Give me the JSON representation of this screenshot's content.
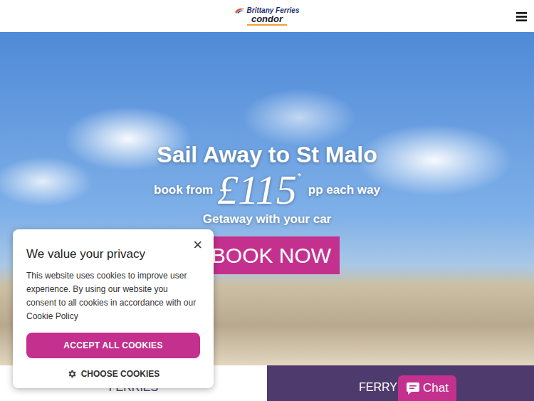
{
  "header": {
    "logo": {
      "brand": "Brittany Ferries",
      "sub": "condor"
    }
  },
  "hero": {
    "title": "Sail Away to St Malo",
    "book_from": "book from",
    "price": "£115",
    "asterisk": "*",
    "unit": "pp each way",
    "subtitle": "Getaway with your car",
    "button": "BOOK NOW"
  },
  "tabs": [
    {
      "label": "FERRIES",
      "selected": false
    },
    {
      "label": "FERRY -",
      "selected": true
    }
  ],
  "cookie": {
    "title": "We value your privacy",
    "close": "×",
    "body": "This website uses cookies to improve user experience. By using our website you consent to all cookies in accordance with our Cookie Policy",
    "accept": "ACCEPT ALL COOKIES",
    "choose": "CHOOSE COOKIES"
  },
  "chat": {
    "label": "Chat"
  }
}
